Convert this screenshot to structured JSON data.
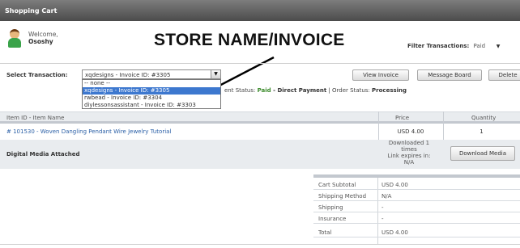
{
  "title_bar": "Shopping Cart",
  "welcome": {
    "greeting": "Welcome,",
    "username": "Ososhy"
  },
  "annotation": "STORE NAME/INVOICE",
  "filter": {
    "label": "Filter Transactions:",
    "value": "Paid"
  },
  "select_transaction": {
    "label": "Select Transaction:",
    "value": "xqdesigns - Invoice ID: #3305",
    "options": [
      "-- none --",
      "xqdesigns - Invoice ID: #3305",
      "rwbead - Invoice ID: #3304",
      "diylessonsassistant - Invoice ID: #3303"
    ],
    "highlighted_index": 1
  },
  "buttons": {
    "view_invoice": "View Invoice",
    "message_board": "Message Board",
    "delete": "Delete"
  },
  "status": {
    "prefix": "ent Status: ",
    "payment_status": "Paid",
    "payment_method": " - Direct Payment",
    "separator": " | Order Status: ",
    "order_status": "Processing"
  },
  "table": {
    "headers": {
      "item": "Item ID - Item Name",
      "price": "Price",
      "quantity": "Quantity"
    },
    "row": {
      "item": "# 101530 - Woven Dangling Pendant Wire Jewelry Tutorial",
      "price": "USD 4.00",
      "quantity": "1"
    },
    "digital_media": {
      "label": "Digital Media Attached",
      "info": [
        "Downloaded 1",
        "times",
        "Link expires in:",
        "N/A"
      ],
      "button": "Download Media"
    }
  },
  "totals": [
    {
      "label": "Cart Subtotal",
      "value": "USD 4.00"
    },
    {
      "label": "Shipping Method",
      "value": "N/A"
    },
    {
      "label": "Shipping",
      "value": "-"
    },
    {
      "label": "Insurance",
      "value": "-"
    },
    {
      "label": "Total",
      "value": "USD 4.00"
    }
  ],
  "colors": {
    "title_bar": "#5f5f5f",
    "paid": "#3a8a2a",
    "link": "#2a5fa6",
    "highlight": "#3d78cf"
  }
}
